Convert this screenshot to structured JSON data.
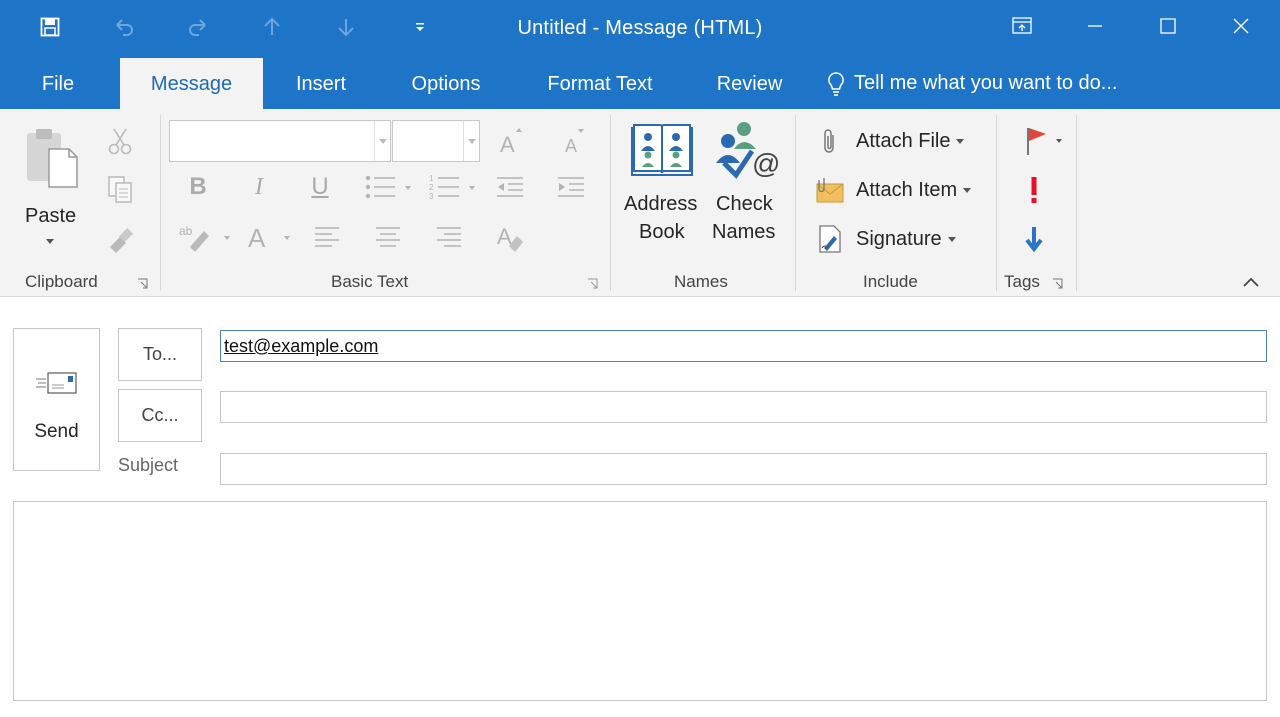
{
  "window": {
    "title": "Untitled - Message (HTML)"
  },
  "qat": {
    "icons": [
      "save-icon",
      "undo-icon",
      "redo-icon",
      "up-arrow-icon",
      "down-arrow-icon",
      "customize-qat-icon"
    ]
  },
  "tabs": [
    {
      "label": "File",
      "active": false
    },
    {
      "label": "Message",
      "active": true
    },
    {
      "label": "Insert",
      "active": false
    },
    {
      "label": "Options",
      "active": false
    },
    {
      "label": "Format Text",
      "active": false
    },
    {
      "label": "Review",
      "active": false
    }
  ],
  "tellme": {
    "label": "Tell me what you want to do..."
  },
  "ribbon": {
    "clipboard": {
      "label": "Clipboard",
      "paste_label": "Paste"
    },
    "basic_text": {
      "label": "Basic Text",
      "font_name": "",
      "font_size": "",
      "bold": "B",
      "italic": "I",
      "underline": "U"
    },
    "names": {
      "label": "Names",
      "address_book_line1": "Address",
      "address_book_line2": "Book",
      "check_names_line1": "Check",
      "check_names_line2": "Names"
    },
    "include": {
      "label": "Include",
      "attach_file": "Attach File",
      "attach_item": "Attach Item",
      "signature": "Signature"
    },
    "tags": {
      "label": "Tags"
    }
  },
  "compose": {
    "send_label": "Send",
    "to_label": "To...",
    "cc_label": "Cc...",
    "subject_label": "Subject",
    "to_value": "test@example.com",
    "cc_value": "",
    "subject_value": "",
    "body_value": ""
  },
  "colors": {
    "accent": "#1e74c6",
    "ribbon_bg": "#f3f3f3",
    "flag_red": "#e0463a",
    "importance_red": "#e81123",
    "low_importance_blue": "#2b74c6"
  }
}
